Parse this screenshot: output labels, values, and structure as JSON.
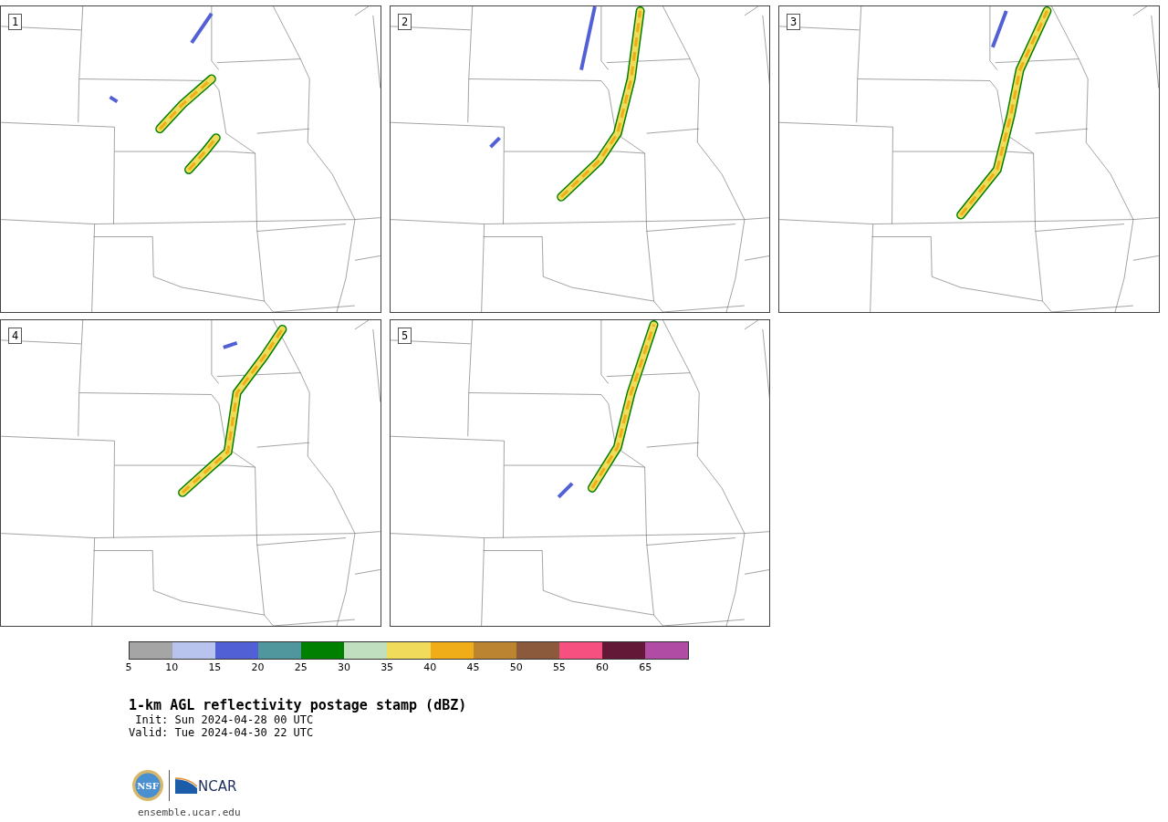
{
  "panels": [
    {
      "label": "1"
    },
    {
      "label": "2"
    },
    {
      "label": "3"
    },
    {
      "label": "4"
    },
    {
      "label": "5"
    }
  ],
  "colorbar": {
    "segments": [
      {
        "color": "#a5a5a5",
        "tick": "5"
      },
      {
        "color": "#b8c4ee",
        "tick": "10"
      },
      {
        "color": "#5260d6",
        "tick": "15"
      },
      {
        "color": "#4f979c",
        "tick": "20"
      },
      {
        "color": "#008000",
        "tick": "25"
      },
      {
        "color": "#bfdfbf",
        "tick": "30"
      },
      {
        "color": "#f0db5a",
        "tick": "35"
      },
      {
        "color": "#f0ad18",
        "tick": "40"
      },
      {
        "color": "#ba8430",
        "tick": "45"
      },
      {
        "color": "#8b5a3c",
        "tick": "50"
      },
      {
        "color": "#f55080",
        "tick": "55"
      },
      {
        "color": "#631837",
        "tick": "60"
      },
      {
        "color": "#b04ca4",
        "tick": "65"
      }
    ]
  },
  "caption": {
    "title": "1-km AGL reflectivity postage stamp (dBZ)",
    "init": " Init: Sun 2024-04-28 00 UTC",
    "valid": "Valid: Tue 2024-04-30 22 UTC"
  },
  "logos": {
    "seal_text": "NSF",
    "wordmark": "NCAR",
    "url": "ensemble.ucar.edu"
  }
}
